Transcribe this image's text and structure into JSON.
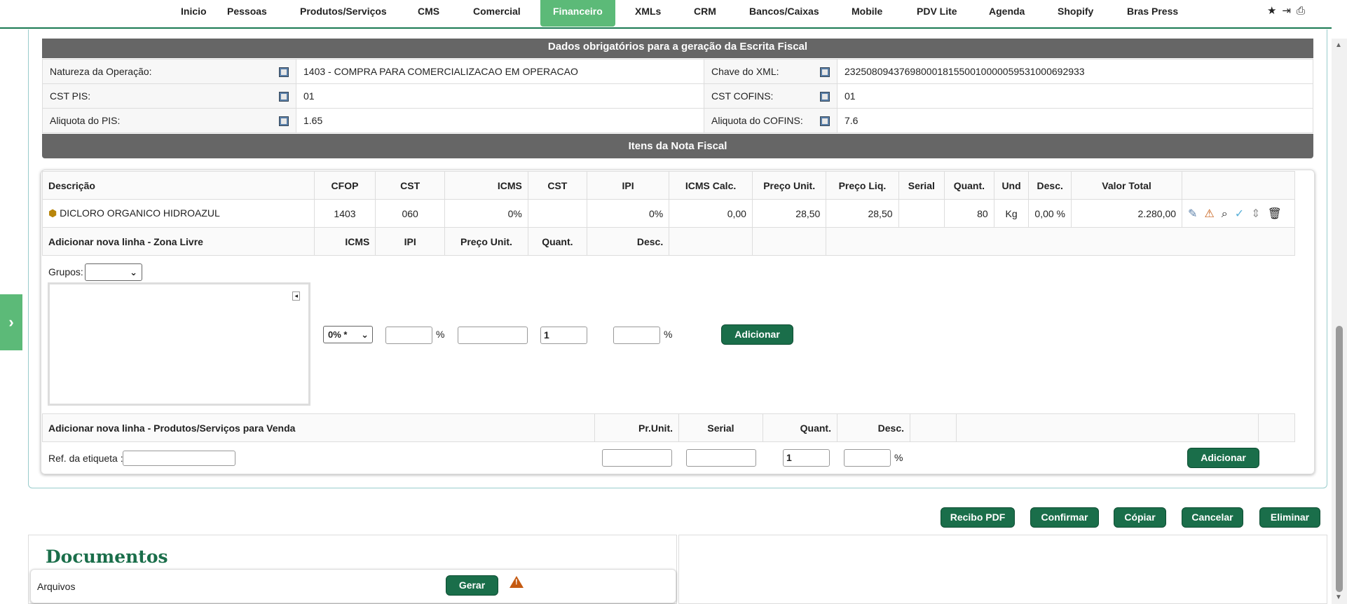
{
  "nav": {
    "items": [
      "Inicio",
      "Pessoas",
      "Produtos/Serviços",
      "CMS",
      "Comercial",
      "Financeiro",
      "XMLs",
      "CRM",
      "Bancos/Caixas",
      "Mobile",
      "PDV Lite",
      "Agenda",
      "Shopify",
      "Bras Press"
    ],
    "active": "Financeiro",
    "icons": [
      "star-icon",
      "logout-icon",
      "print-icon"
    ]
  },
  "fiscal": {
    "title": "Dados obrigatórios para a geração da Escrita Fiscal",
    "natureza_label": "Natureza da Operação:",
    "natureza_value": "1403 - COMPRA PARA COMERCIALIZACAO EM OPERACAO",
    "chave_label": "Chave do XML:",
    "chave_value": "23250809437698000181550010000059531000692933",
    "cst_pis_label": "CST PIS:",
    "cst_pis_value": "01",
    "cst_cofins_label": "CST COFINS:",
    "cst_cofins_value": "01",
    "aliq_pis_label": "Aliquota do PIS:",
    "aliq_pis_value": "1.65",
    "aliq_cofins_label": "Aliquota do COFINS:",
    "aliq_cofins_value": "7.6"
  },
  "items": {
    "title": "Itens da Nota Fiscal",
    "headers": [
      "Descrição",
      "CFOP",
      "CST",
      "ICMS",
      "CST",
      "IPI",
      "ICMS Calc.",
      "Preço Unit.",
      "Preço Liq.",
      "Serial",
      "Quant.",
      "Und",
      "Desc.",
      "Valor Total"
    ],
    "row": {
      "descricao": "DICLORO ORGANICO HIDROAZUL",
      "cfop": "1403",
      "cst": "060",
      "icms": "0%",
      "cst2": "",
      "ipi": "0%",
      "icms_calc": "0,00",
      "preco_unit": "28,50",
      "preco_liq": "28,50",
      "serial": "",
      "quant": "80",
      "und": "Kg",
      "desc": "0,00 %",
      "valor_total": "2.280,00"
    }
  },
  "zona": {
    "title": "Adicionar nova linha - Zona Livre",
    "headers": [
      "ICMS",
      "IPI",
      "Preço Unit.",
      "Quant.",
      "Desc."
    ],
    "grupos_label": "Grupos:",
    "icms_select": "0% *",
    "pct": "%",
    "quant_value": "1",
    "add_label": "Adicionar"
  },
  "venda": {
    "title": "Adicionar nova linha - Produtos/Serviços para Venda",
    "headers": [
      "Pr.Unit.",
      "Serial",
      "Quant.",
      "Desc."
    ],
    "ref_label": "Ref. da etiqueta :",
    "quant_value": "1",
    "pct": "%",
    "add_label": "Adicionar"
  },
  "actions": [
    "Recibo PDF",
    "Confirmar",
    "Cópiar",
    "Cancelar",
    "Eliminar"
  ],
  "docs": {
    "title": "Documentos",
    "arquivos_label": "Arquivos",
    "gerar_label": "Gerar"
  },
  "colors": {
    "green": "#1a6e4a",
    "nav_active": "#5cba78",
    "bar": "#666666"
  }
}
